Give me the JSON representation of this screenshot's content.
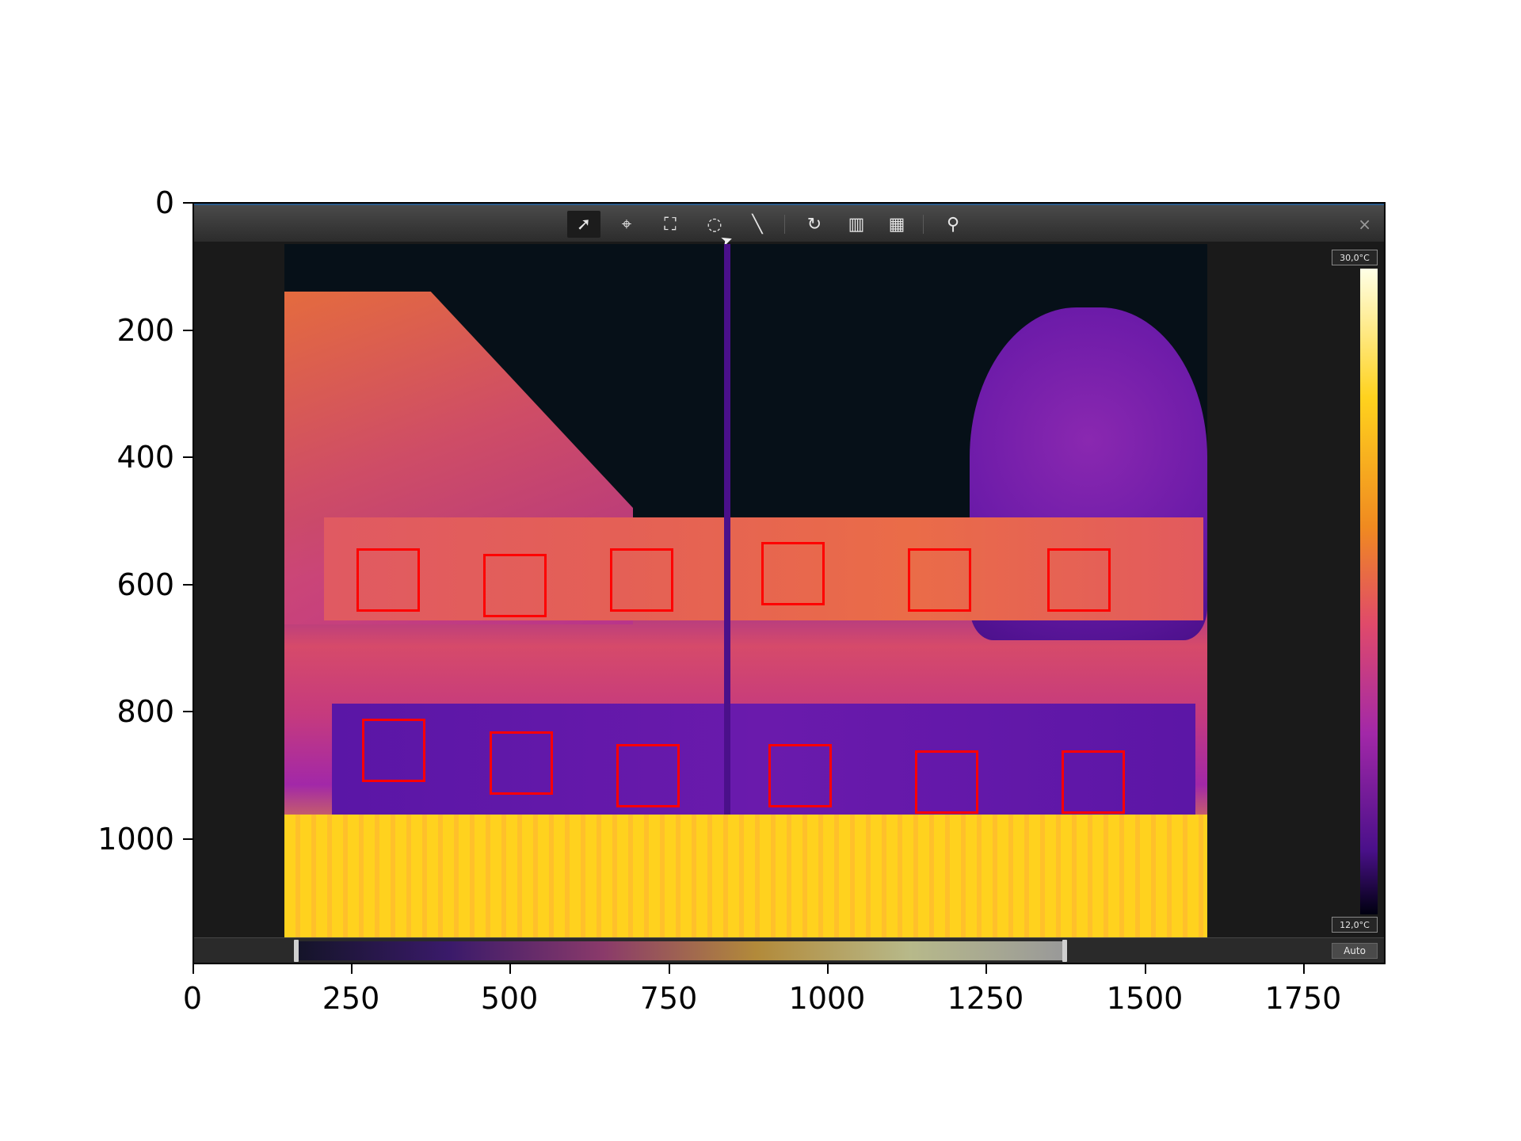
{
  "toolbar": {
    "icons": [
      "select-icon",
      "crosshair-icon",
      "marquee-icon",
      "circle-select-icon",
      "line-icon",
      "rotate-icon",
      "palette-icon",
      "color-image-icon",
      "search-icon"
    ],
    "close_label": "×"
  },
  "temperature_scale": {
    "max_label": "30,0°C",
    "min_label": "12,0°C"
  },
  "histogram": {
    "auto_label": "Auto"
  },
  "axes": {
    "x_ticks": [
      "0",
      "250",
      "500",
      "750",
      "1000",
      "1250",
      "1500",
      "1750"
    ],
    "y_ticks": [
      "0",
      "200",
      "400",
      "600",
      "800",
      "1000"
    ]
  }
}
